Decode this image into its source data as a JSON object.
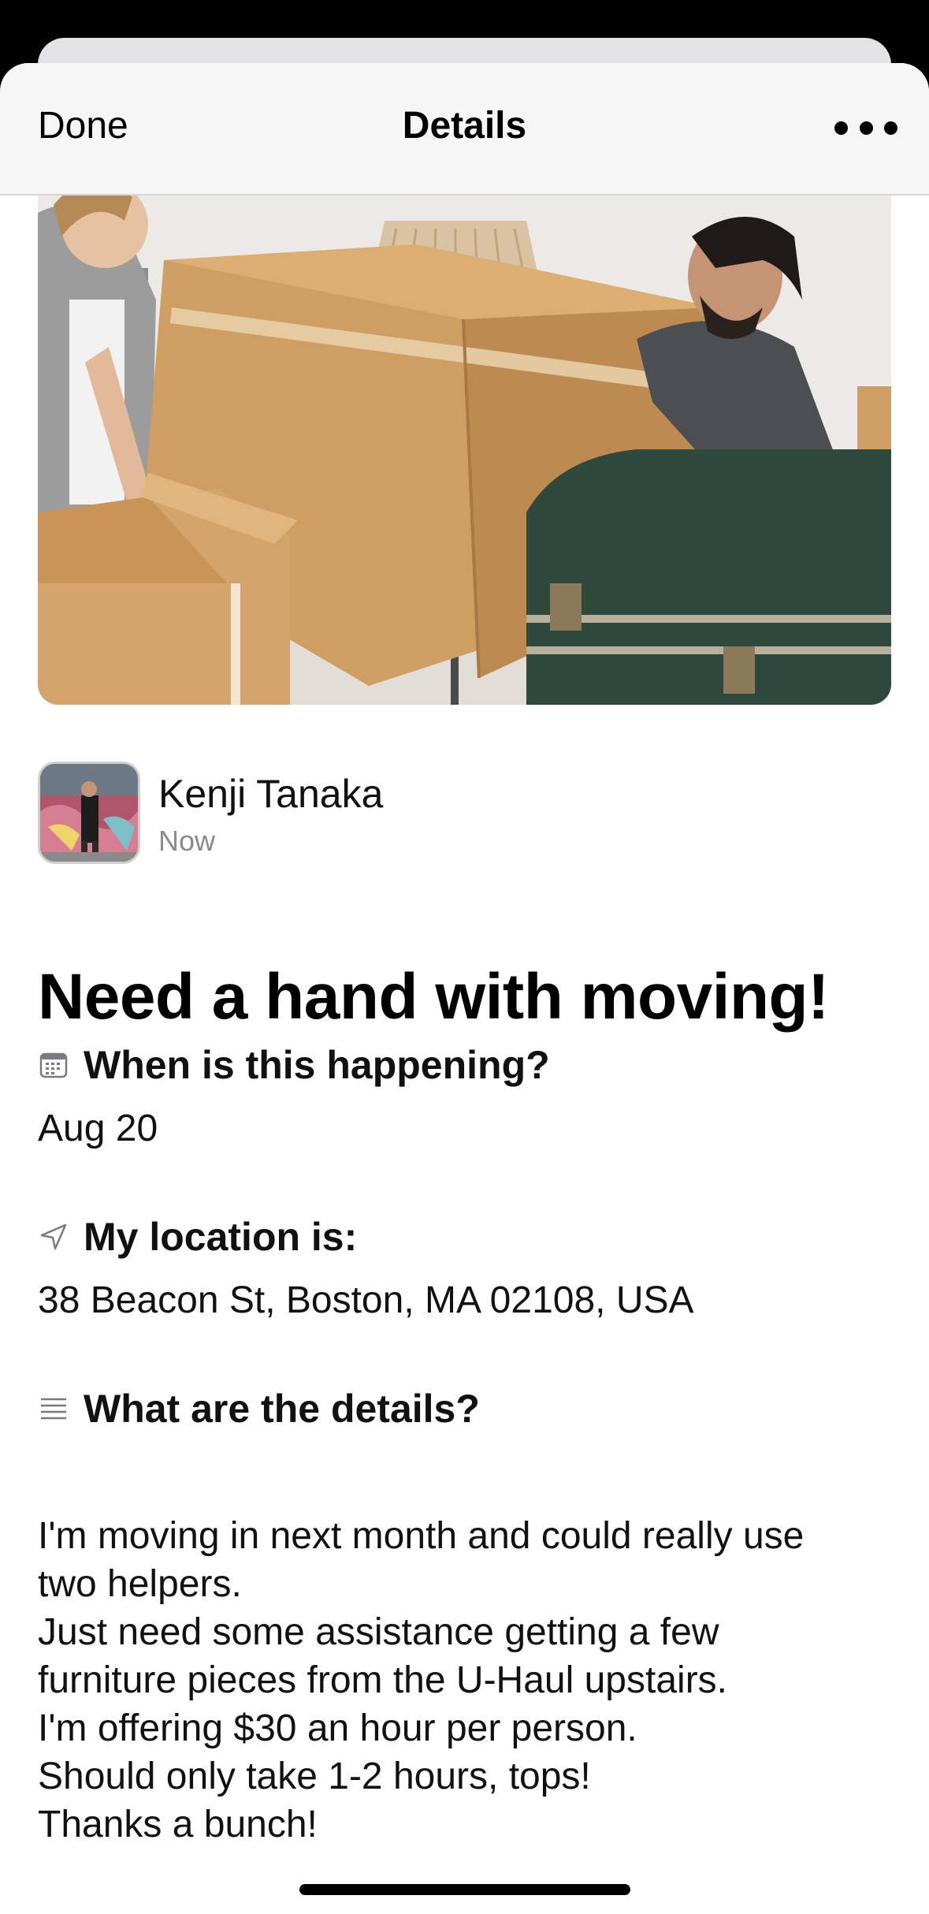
{
  "nav": {
    "done_label": "Done",
    "title": "Details",
    "more_icon": "ellipsis-icon"
  },
  "post": {
    "image_description_icon": "moving-boxes-photo",
    "author": {
      "name": "Kenji Tanaka",
      "time": "Now"
    },
    "title": "Need a hand with moving!",
    "sections": {
      "when": {
        "icon": "calendar-icon",
        "label": "When is this happening?",
        "value": "Aug 20"
      },
      "location": {
        "icon": "location-arrow-icon",
        "label": "My location is:",
        "value": "38 Beacon St, Boston, MA 02108, USA"
      },
      "details": {
        "icon": "text-lines-icon",
        "label": "What are the details?",
        "lines": [
          "I'm moving in next month and could really use",
          "two helpers.",
          "Just need some assistance getting a few",
          "furniture pieces from the U-Haul upstairs.",
          "I'm offering $30 an hour per person.",
          "Should only take 1-2 hours, tops!",
          "Thanks a bunch!"
        ]
      }
    }
  },
  "colors": {
    "nav_background": "#f6f6f7",
    "secondary_text": "#8a8a8e",
    "box_cardboard": "#cf9e62",
    "suitcase_green": "#2f4a3c"
  }
}
